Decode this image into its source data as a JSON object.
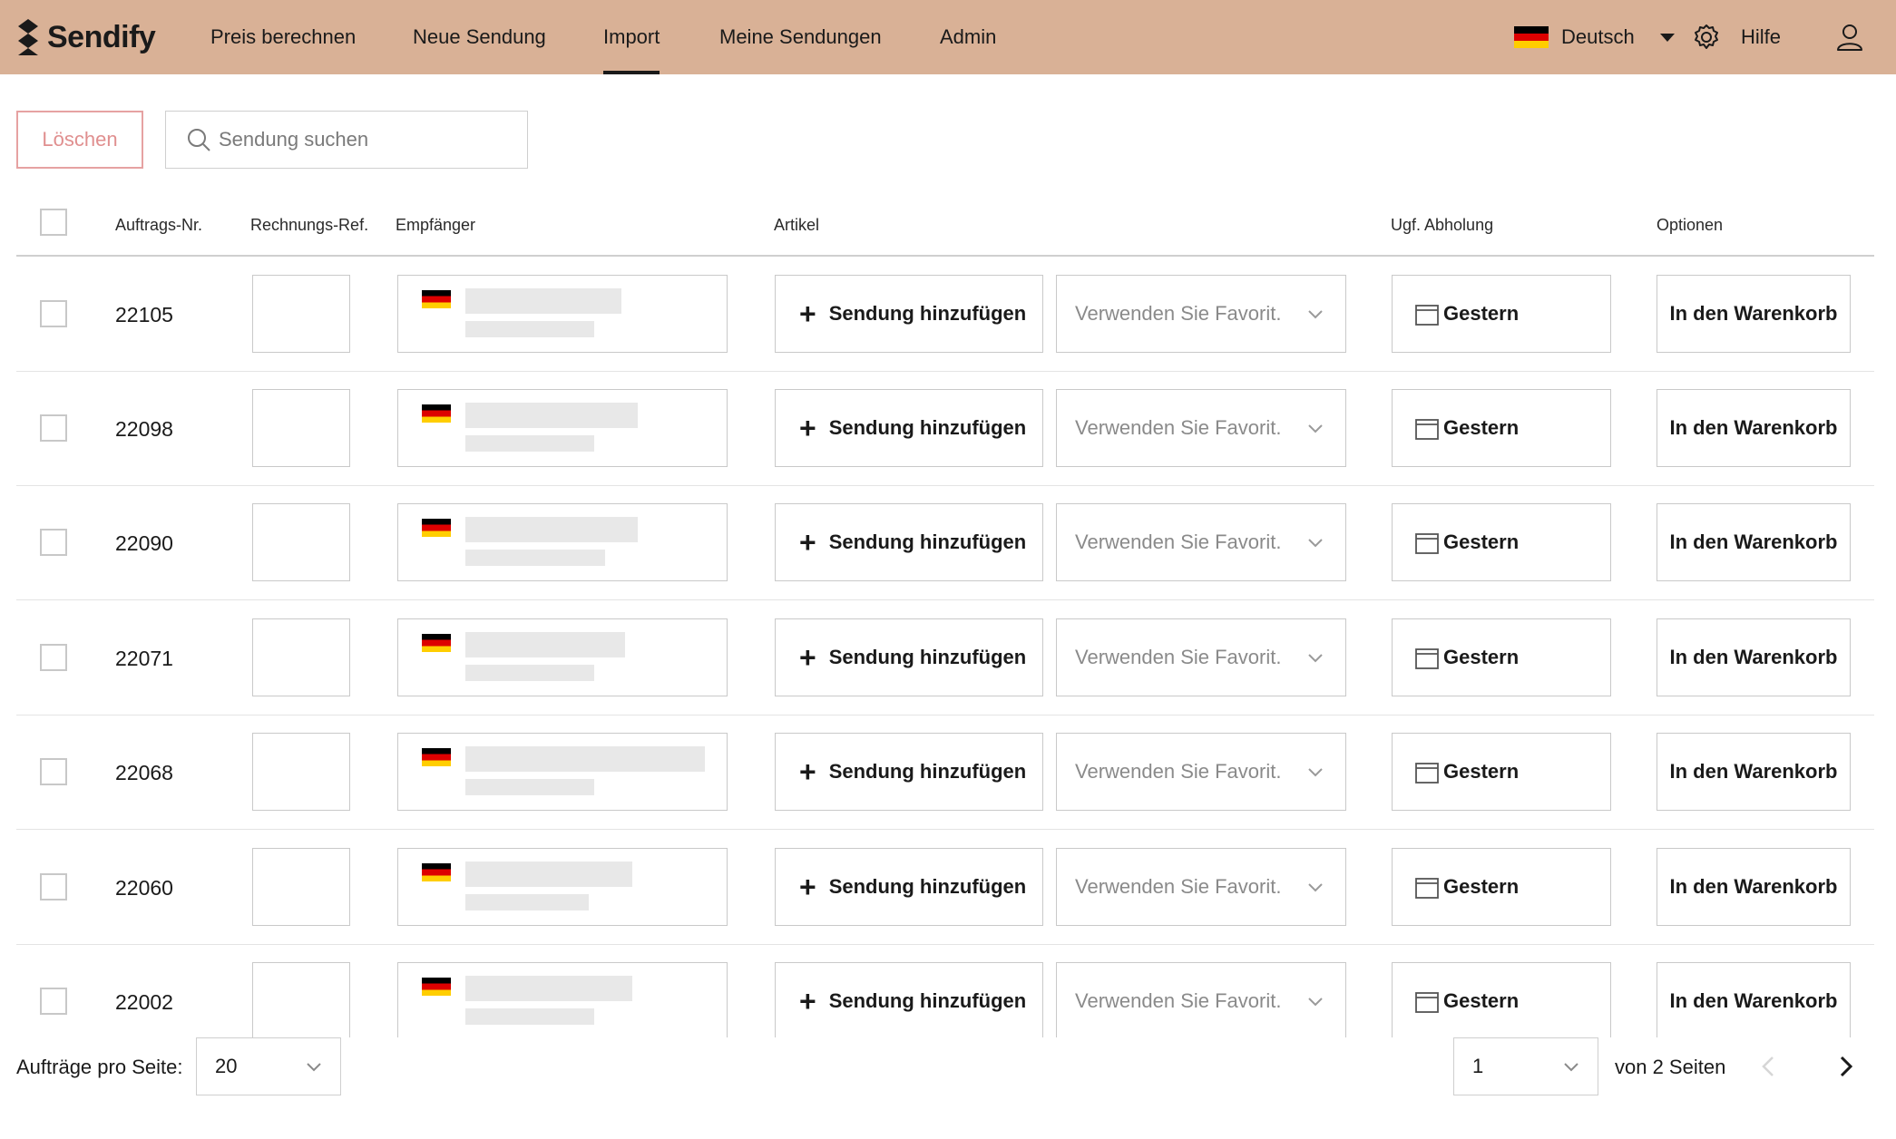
{
  "app": {
    "logo_text": "Sendify"
  },
  "nav": {
    "items": [
      {
        "label": "Preis berechnen",
        "active": false
      },
      {
        "label": "Neue Sendung",
        "active": false
      },
      {
        "label": "Import",
        "active": true
      },
      {
        "label": "Meine Sendungen",
        "active": false
      },
      {
        "label": "Admin",
        "active": false
      }
    ],
    "language": "Deutsch",
    "help": "Hilfe"
  },
  "toolbar": {
    "delete_label": "Löschen",
    "search_placeholder": "Sendung suchen"
  },
  "table": {
    "headers": {
      "order_nr": "Auftrags-Nr.",
      "invoice_ref": "Rechnungs-Ref.",
      "recipient": "Empfänger",
      "article": "Artikel",
      "pickup": "Ugf. Abholung",
      "options": "Optionen"
    },
    "rows": [
      {
        "order_nr": "22105",
        "add_label": "Sendung hinzufügen",
        "favorite_placeholder": "Verwenden Sie Favorit.",
        "pickup": "Gestern",
        "cart_label": "In den Warenkorb"
      },
      {
        "order_nr": "22098",
        "add_label": "Sendung hinzufügen",
        "favorite_placeholder": "Verwenden Sie Favorit.",
        "pickup": "Gestern",
        "cart_label": "In den Warenkorb"
      },
      {
        "order_nr": "22090",
        "add_label": "Sendung hinzufügen",
        "favorite_placeholder": "Verwenden Sie Favorit.",
        "pickup": "Gestern",
        "cart_label": "In den Warenkorb"
      },
      {
        "order_nr": "22071",
        "add_label": "Sendung hinzufügen",
        "favorite_placeholder": "Verwenden Sie Favorit.",
        "pickup": "Gestern",
        "cart_label": "In den Warenkorb"
      },
      {
        "order_nr": "22068",
        "add_label": "Sendung hinzufügen",
        "favorite_placeholder": "Verwenden Sie Favorit.",
        "pickup": "Gestern",
        "cart_label": "In den Warenkorb"
      },
      {
        "order_nr": "22060",
        "add_label": "Sendung hinzufügen",
        "favorite_placeholder": "Verwenden Sie Favorit.",
        "pickup": "Gestern",
        "cart_label": "In den Warenkorb"
      },
      {
        "order_nr": "22002",
        "add_label": "Sendung hinzufügen",
        "favorite_placeholder": "Verwenden Sie Favorit.",
        "pickup": "Gestern",
        "cart_label": "In den Warenkorb"
      }
    ]
  },
  "footer": {
    "per_page_label": "Aufträge pro Seite:",
    "per_page_value": "20",
    "page_value": "1",
    "page_of": "von 2 Seiten"
  },
  "colors": {
    "header_bg": "#d9b196",
    "delete_accent": "#e08f8f"
  }
}
